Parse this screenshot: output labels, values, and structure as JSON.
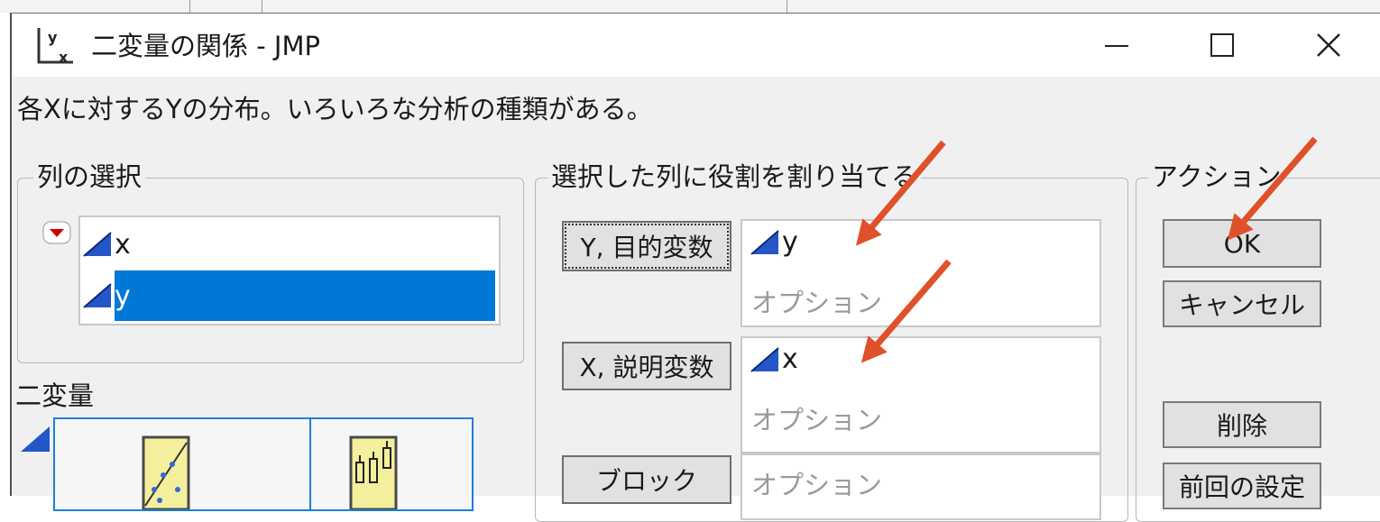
{
  "window": {
    "title": "二変量の関係 - JMP",
    "description": "各Xに対するYの分布。いろいろな分析の種類がある。"
  },
  "columns_group": {
    "label": "列の選択",
    "items": [
      {
        "label": "x",
        "selected": false
      },
      {
        "label": "y",
        "selected": true
      }
    ]
  },
  "roles_group": {
    "label": "選択した列に役割を割り当てる",
    "roles": [
      {
        "button": "Y, 目的変数",
        "value": "y",
        "option": "オプション"
      },
      {
        "button": "X, 説明変数",
        "value": "x",
        "option": "オプション"
      },
      {
        "button": "ブロック",
        "value": "",
        "option": "オプション"
      }
    ]
  },
  "actions_group": {
    "label": "アクション",
    "ok": "OK",
    "cancel": "キャンセル",
    "remove": "削除",
    "recall": "前回の設定"
  },
  "bivariate": {
    "label": "二変量"
  },
  "colors": {
    "selection": "#0078d7",
    "annotation_arrow": "#e0502a",
    "continuous_icon": "#2456c8"
  }
}
